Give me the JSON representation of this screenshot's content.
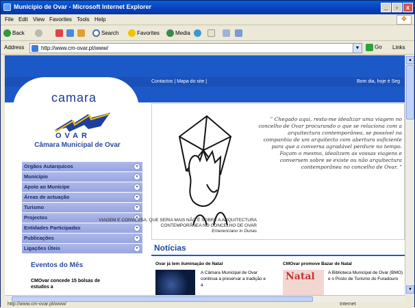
{
  "window": {
    "title": "Município de Ovar - Microsoft Internet Explorer",
    "controls": [
      "_",
      "▫",
      "x"
    ]
  },
  "menubar": {
    "items": [
      "File",
      "Edit",
      "View",
      "Favorites",
      "Tools",
      "Help"
    ]
  },
  "toolbar": {
    "back": "Back",
    "search": "Search",
    "favorites": "Favorites",
    "media": "Media"
  },
  "addressbar": {
    "label": "Address",
    "url": "http://www.cm-ovar.pt/www/",
    "go": "Go",
    "links": "Links"
  },
  "page": {
    "topnav_links": "Contactos | Mapa do site |",
    "greeting": "Bom dia, hoje é Seg",
    "logo_word": "camara",
    "logo_sub": "OVAR",
    "city_title": "Câmara Municipal de Ovar",
    "menu": [
      "Orgãos Autarquicos",
      "Município",
      "Apoio ao Munícipe",
      "Áreas de actuação",
      "Turismo",
      "Projectos",
      "Entidades Participadas",
      "Publicações",
      "Ligações Úteis"
    ],
    "events_title": "Eventos do Mês",
    "events_item": "CMOvar concede 15 bolsas de estudos a",
    "quote": "\" Chegado aqui, resta-me idealizar uma viagem no concelho de Ovar procurando o que se relaciona com a arquitectura contemporânea, se possível na companhia de um arquitecto com abertura suficiente para que a conversa agradável perdure no tempo. Façam o mesmo, idealizem as vossas viagens e conversem sobre se existe ou não arquitectura contemporânea no concelho de Ovar. \"",
    "caption": "VIAGEM E CONVERSA, QUE SERIA MAIS NÃO É SOBRE A ARQUITECTURA CONTEMPORÂNEA NO CONCELHO DE OVAR",
    "caption_author": "Emerenciano in Dunas",
    "news_title": "Notícias",
    "news": [
      {
        "head": "Ovar já tem iluminação de Natal",
        "text": "A Câmara Municipal de Ovar continua a preservar a tradição e a"
      },
      {
        "head": "CMOvar promove Bazar de Natal",
        "badge": "Natal",
        "text": "A Biblioteca Municipal de Ovar (BMO) e o Posto de Turismo do Furadouro"
      }
    ]
  },
  "status": {
    "text": "http://www.cm-ovar.pt/www/",
    "zone": "Internet"
  },
  "colors": {
    "brand_blue": "#1c59c8",
    "menu_blue": "#98a6e0",
    "title_blue": "#2a4a9a"
  }
}
